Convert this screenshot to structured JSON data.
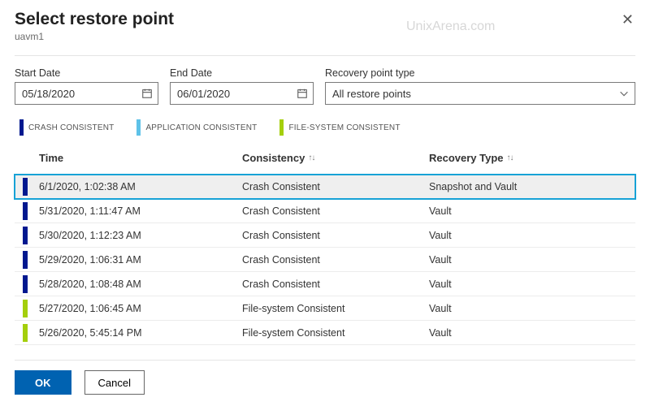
{
  "meta": {
    "watermark": "UnixArena.com"
  },
  "header": {
    "title": "Select restore point",
    "subtitle": "uavm1"
  },
  "filters": {
    "start_date_label": "Start Date",
    "start_date_value": "05/18/2020",
    "end_date_label": "End Date",
    "end_date_value": "06/01/2020",
    "recovery_type_label": "Recovery point type",
    "recovery_type_value": "All restore points"
  },
  "legend": {
    "crash": "CRASH CONSISTENT",
    "app": "APPLICATION CONSISTENT",
    "fs": "FILE-SYSTEM CONSISTENT"
  },
  "table": {
    "headers": {
      "time": "Time",
      "consistency": "Consistency",
      "recovery_type": "Recovery Type"
    },
    "rows": [
      {
        "time": "6/1/2020, 1:02:38 AM",
        "consistency": "Crash Consistent",
        "recovery_type": "Snapshot and Vault",
        "bar": "crash",
        "selected": true
      },
      {
        "time": "5/31/2020, 1:11:47 AM",
        "consistency": "Crash Consistent",
        "recovery_type": "Vault",
        "bar": "crash",
        "selected": false
      },
      {
        "time": "5/30/2020, 1:12:23 AM",
        "consistency": "Crash Consistent",
        "recovery_type": "Vault",
        "bar": "crash",
        "selected": false
      },
      {
        "time": "5/29/2020, 1:06:31 AM",
        "consistency": "Crash Consistent",
        "recovery_type": "Vault",
        "bar": "crash",
        "selected": false
      },
      {
        "time": "5/28/2020, 1:08:48 AM",
        "consistency": "Crash Consistent",
        "recovery_type": "Vault",
        "bar": "crash",
        "selected": false
      },
      {
        "time": "5/27/2020, 1:06:45 AM",
        "consistency": "File-system Consistent",
        "recovery_type": "Vault",
        "bar": "fs",
        "selected": false
      },
      {
        "time": "5/26/2020, 5:45:14 PM",
        "consistency": "File-system Consistent",
        "recovery_type": "Vault",
        "bar": "fs",
        "selected": false
      }
    ]
  },
  "footer": {
    "ok": "OK",
    "cancel": "Cancel"
  }
}
